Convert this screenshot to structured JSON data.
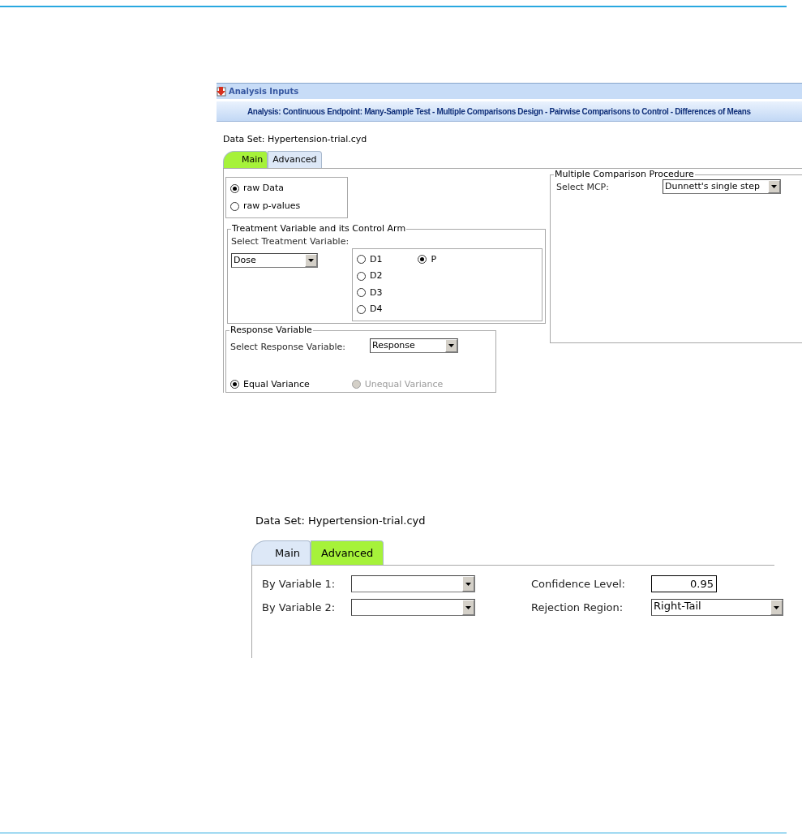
{
  "analysis_window": {
    "title": "Analysis Inputs",
    "banner": "Analysis: Continuous Endpoint: Many-Sample Test - Multiple Comparisons Design - Pairwise Comparisons to Control - Differences of Means",
    "dataset": "Data Set: Hypertension-trial.cyd",
    "tabs": [
      {
        "label": "Main",
        "selected": true
      },
      {
        "label": "Advanced",
        "selected": false
      }
    ],
    "input_type": [
      {
        "label": "raw Data",
        "selected": true
      },
      {
        "label": "raw p-values",
        "selected": false
      }
    ],
    "treatment": {
      "legend": "Treatment Variable and its Control Arm",
      "select_label": "Select Treatment Variable:",
      "variable": "Dose",
      "arms": [
        {
          "label": "D1",
          "selected": false
        },
        {
          "label": "D2",
          "selected": false
        },
        {
          "label": "D3",
          "selected": false
        },
        {
          "label": "D4",
          "selected": false
        },
        {
          "label": "P",
          "selected": true
        }
      ]
    },
    "response": {
      "legend": "Response Variable",
      "select_label": "Select Response Variable:",
      "variable": "Response",
      "variance_options": [
        {
          "label": "Equal Variance",
          "selected": true,
          "disabled": false
        },
        {
          "label": "Unequal Variance",
          "selected": false,
          "disabled": true
        }
      ]
    },
    "mcp": {
      "legend": "Multiple Comparison Procedure",
      "select_label": "Select MCP:",
      "value": "Dunnett's single step"
    }
  },
  "advanced_panel": {
    "dataset": "Data Set: Hypertension-trial.cyd",
    "tabs": [
      {
        "label": "Main",
        "selected": false
      },
      {
        "label": "Advanced",
        "selected": true
      }
    ],
    "fields": [
      {
        "label": "By Variable 1:",
        "kind": "dropdown"
      },
      {
        "label": "Confidence Level:",
        "kind": "textbox",
        "value": "0.95"
      },
      {
        "label": "By Variable 2:",
        "kind": "dropdown"
      },
      {
        "label": "Rejection Region:",
        "kind": "dropdown",
        "value": "Right-Tail"
      }
    ]
  }
}
